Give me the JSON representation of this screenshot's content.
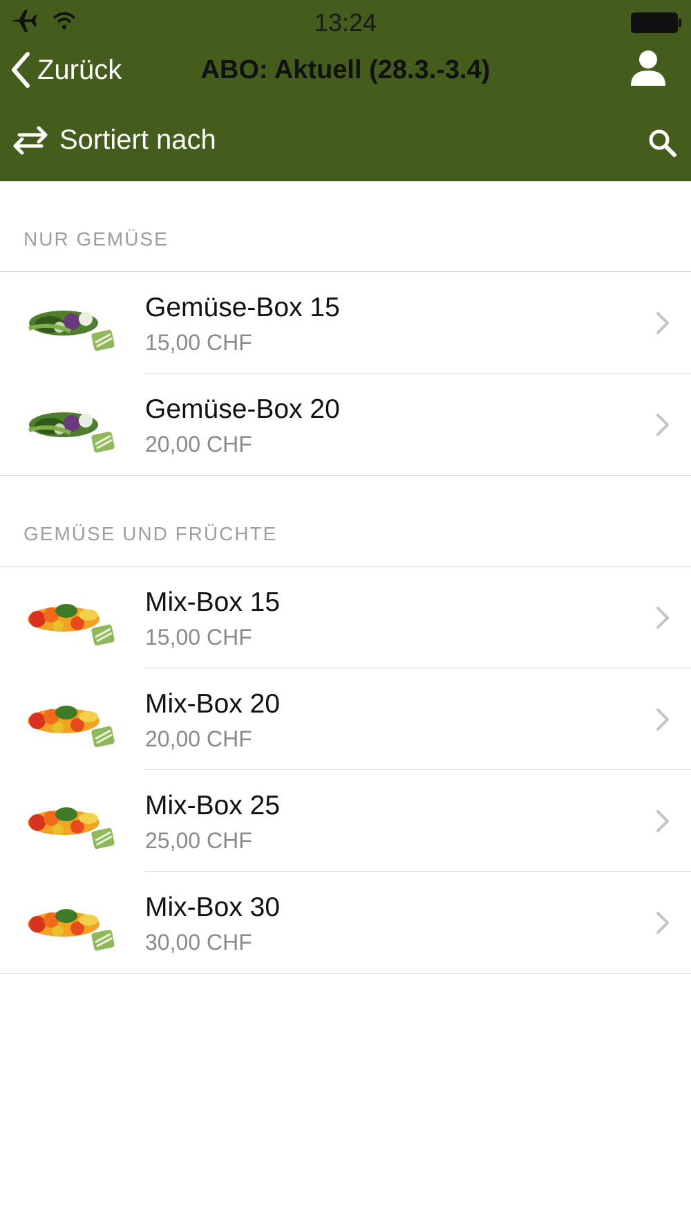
{
  "status": {
    "time": "13:24"
  },
  "nav": {
    "back_label": "Zurück",
    "title": "ABO: Aktuell (28.3.-3.4)"
  },
  "toolbar": {
    "sort_label": "Sortiert nach"
  },
  "sections": [
    {
      "title": "NUR GEMÜSE",
      "items": [
        {
          "name": "Gemüse-Box 15",
          "price": "15,00 CHF"
        },
        {
          "name": "Gemüse-Box 20",
          "price": "20,00 CHF"
        }
      ]
    },
    {
      "title": "GEMÜSE UND FRÜCHTE",
      "items": [
        {
          "name": "Mix-Box 15",
          "price": "15,00 CHF"
        },
        {
          "name": "Mix-Box 20",
          "price": "20,00 CHF"
        },
        {
          "name": "Mix-Box 25",
          "price": "25,00 CHF"
        },
        {
          "name": "Mix-Box 30",
          "price": "30,00 CHF"
        }
      ]
    }
  ],
  "colors": {
    "header_bg": "#455d1c",
    "section_title": "#9e9e9e",
    "price_text": "#8a8a8a"
  },
  "icons": [
    "airplane-icon",
    "wifi-icon",
    "battery-icon",
    "back-chevron-icon",
    "user-icon",
    "swap-arrows-icon",
    "search-icon",
    "chevron-right-icon",
    "vegetable-box-thumbnail",
    "mixed-box-thumbnail"
  ]
}
